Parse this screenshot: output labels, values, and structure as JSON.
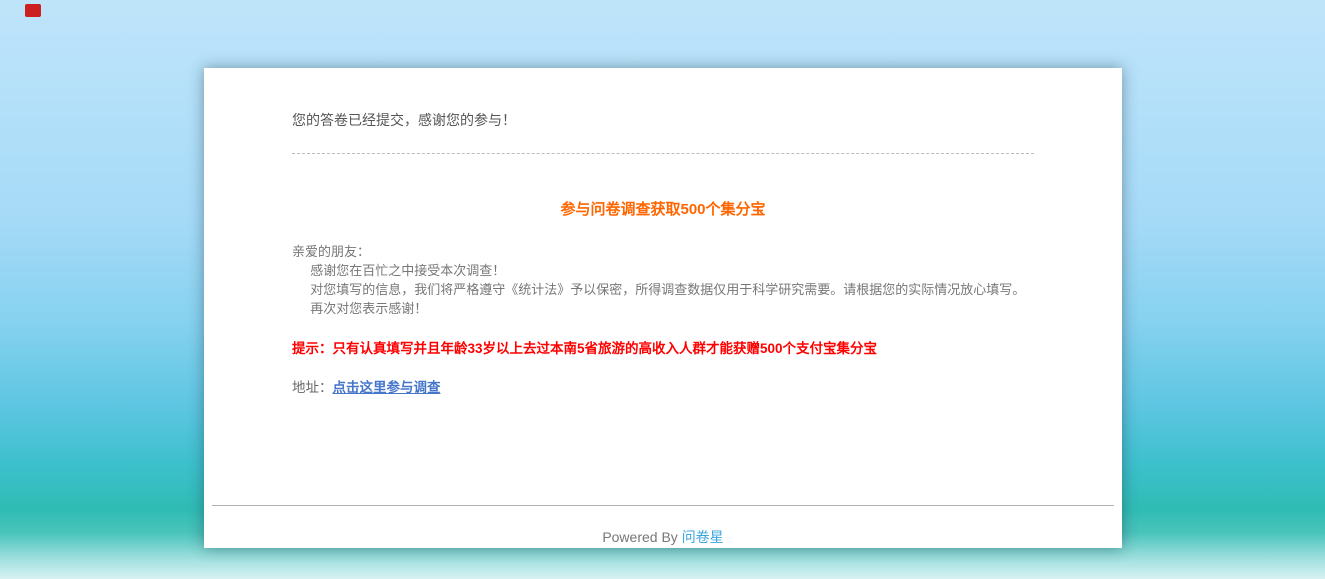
{
  "page": {
    "red_marker_color": "#cc2020",
    "background_top_color": "#bfe4fa",
    "background_sea_color": "#2fbcb4"
  },
  "card": {
    "submitted_message": "您的答卷已经提交，感谢您的参与！",
    "promo_title": "参与问卷调查获取500个集分宝",
    "promo_title_color": "#ff6600",
    "greeting_lines": [
      "亲爱的朋友：",
      "感谢您在百忙之中接受本次调查！",
      "对您填写的信息，我们将严格遵守《统计法》予以保密，所得调查数据仅用于科学研究需要。请根据您的实际情况放心填写。",
      "再次对您表示感谢！"
    ],
    "hint": "提示：只有认真填写并且年龄33岁以上去过本南5省旅游的高收入人群才能获赠500个支付宝集分宝",
    "hint_color": "#ff0000",
    "address_label": "地址：",
    "address_link": "点击这里参与调查",
    "address_link_color": "#4576c9"
  },
  "footer": {
    "powered_by": "Powered By ",
    "brand": "问卷星",
    "brand_color": "#38a5dc"
  }
}
